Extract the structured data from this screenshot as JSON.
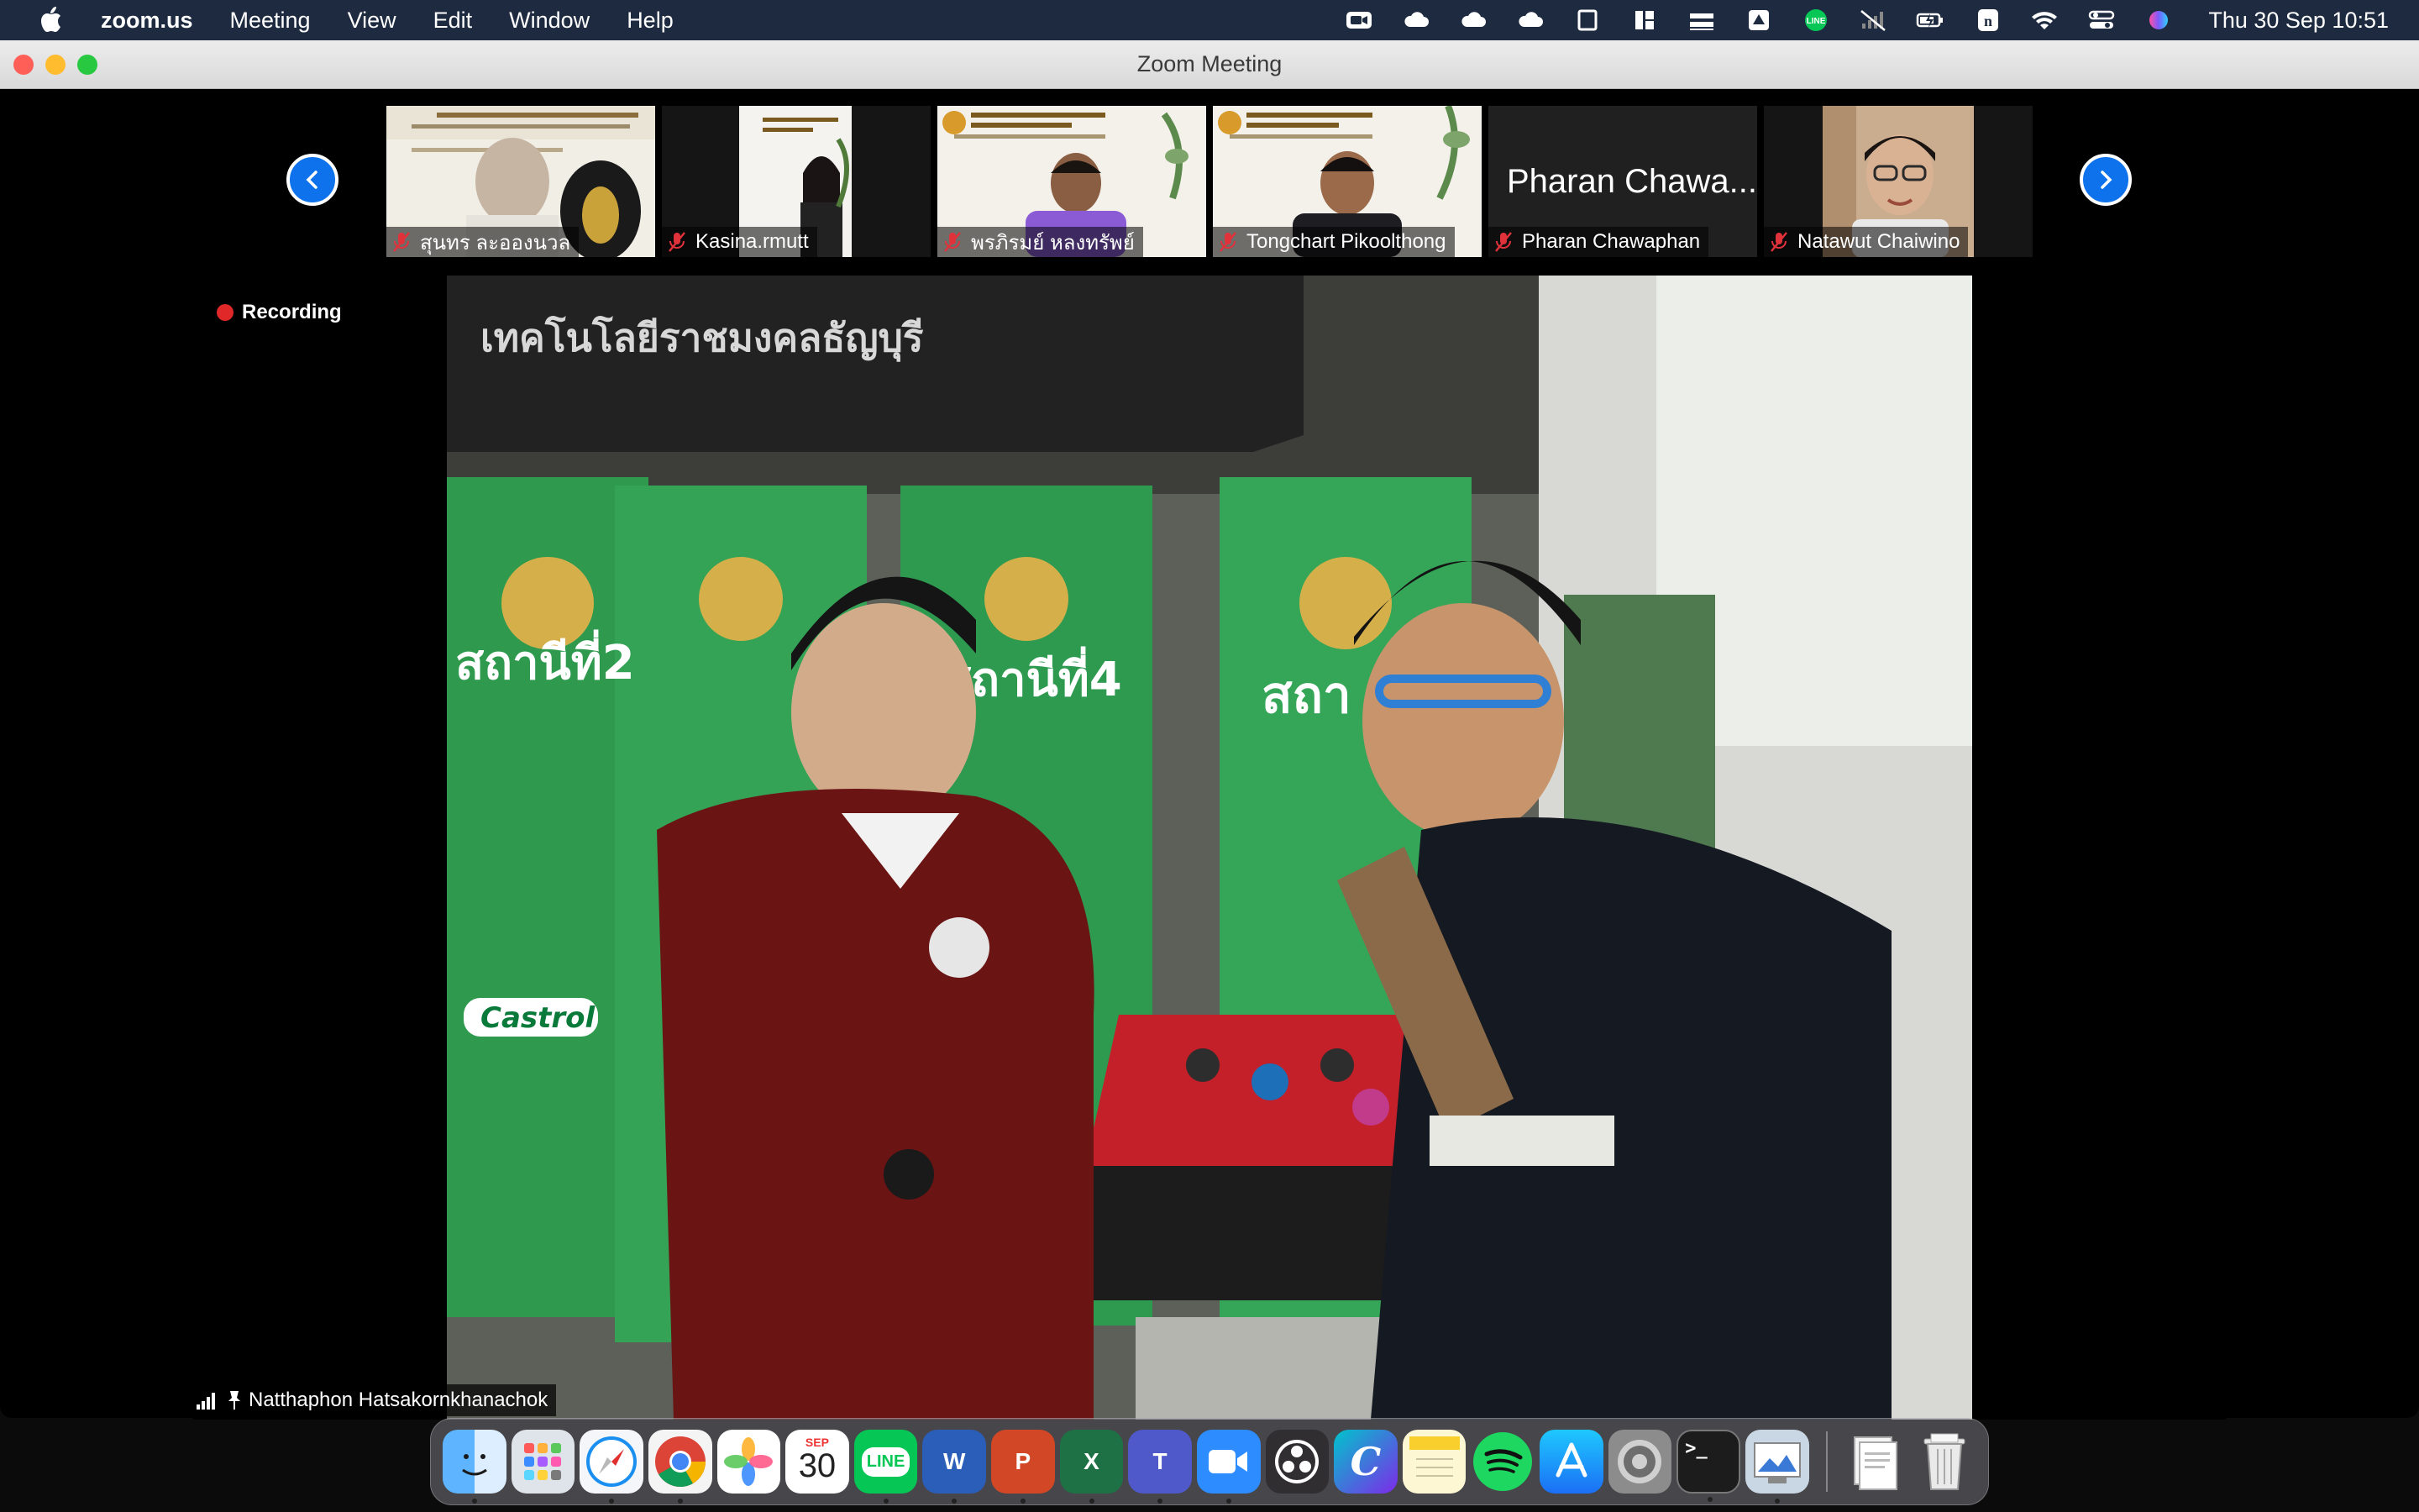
{
  "menubar": {
    "app_name": "zoom.us",
    "menus": [
      "Meeting",
      "View",
      "Edit",
      "Window",
      "Help"
    ],
    "clock": "Thu 30 Sep  10:51"
  },
  "window": {
    "title": "Zoom Meeting"
  },
  "participants": [
    {
      "name": "สุนทร ละอองนวล",
      "muted": true,
      "video": true
    },
    {
      "name": "Kasina.rmutt",
      "muted": true,
      "video": true
    },
    {
      "name": "พรภิรมย์ หลงทรัพย์",
      "muted": true,
      "video": true
    },
    {
      "name": "Tongchart Pikoolthong",
      "muted": true,
      "video": true
    },
    {
      "name": "Pharan Chawaphan",
      "display_name": "Pharan Chawa...",
      "muted": true,
      "video": false
    },
    {
      "name": "Natawut Chaiwino",
      "muted": true,
      "video": true
    }
  ],
  "main_video": {
    "recording_label": "Recording",
    "speaker_name": "Natthaphon Hatsakornkhanachok",
    "banner_text": "เทคโนโลยีราชมงคลธัญบุรี",
    "sign_texts": [
      "สถานีที่2",
      "สถานีที่4",
      "สถา"
    ],
    "brand": "Castrol"
  },
  "dock": {
    "apps": [
      {
        "name": "Finder",
        "color": "#2f8cf0",
        "running": true
      },
      {
        "name": "Launchpad",
        "color": "#d8dde6",
        "running": false
      },
      {
        "name": "Safari",
        "color": "#1a8ff0",
        "running": true
      },
      {
        "name": "Chrome",
        "color": "#ffffff",
        "running": true
      },
      {
        "name": "Photos",
        "color": "#ffffff",
        "running": false
      },
      {
        "name": "Calendar",
        "color": "#ffffff",
        "running": false,
        "month": "SEP",
        "day": "30"
      },
      {
        "name": "LINE",
        "color": "#06c755",
        "running": true,
        "label": "LINE"
      },
      {
        "name": "Word",
        "color": "#2b5eb8",
        "running": true,
        "label": "W"
      },
      {
        "name": "PowerPoint",
        "color": "#d24726",
        "running": true,
        "label": "P"
      },
      {
        "name": "Excel",
        "color": "#1e7145",
        "running": true,
        "label": "X"
      },
      {
        "name": "Teams",
        "color": "#5059c9",
        "running": true,
        "label": "T"
      },
      {
        "name": "Zoom",
        "color": "#2d8cff",
        "running": true
      },
      {
        "name": "OBS",
        "color": "#302e31",
        "running": false
      },
      {
        "name": "Canva",
        "color": "#7d2ae8",
        "running": false,
        "label": "C"
      },
      {
        "name": "Notes",
        "color": "#fdf7d4",
        "running": false
      },
      {
        "name": "Spotify",
        "color": "#1ed760",
        "running": false
      },
      {
        "name": "App Store",
        "color": "#1b8cf5",
        "running": false
      },
      {
        "name": "System Preferences",
        "color": "#8c8c8c",
        "running": false
      },
      {
        "name": "Terminal",
        "color": "#1c1c1c",
        "running": true,
        "label": ">_"
      },
      {
        "name": "Preview",
        "color": "#c9d6e3",
        "running": true
      }
    ],
    "trailing": [
      {
        "name": "Downloads",
        "color": "#dfe6ee"
      },
      {
        "name": "Trash",
        "color": "#e2e2e2"
      }
    ]
  }
}
